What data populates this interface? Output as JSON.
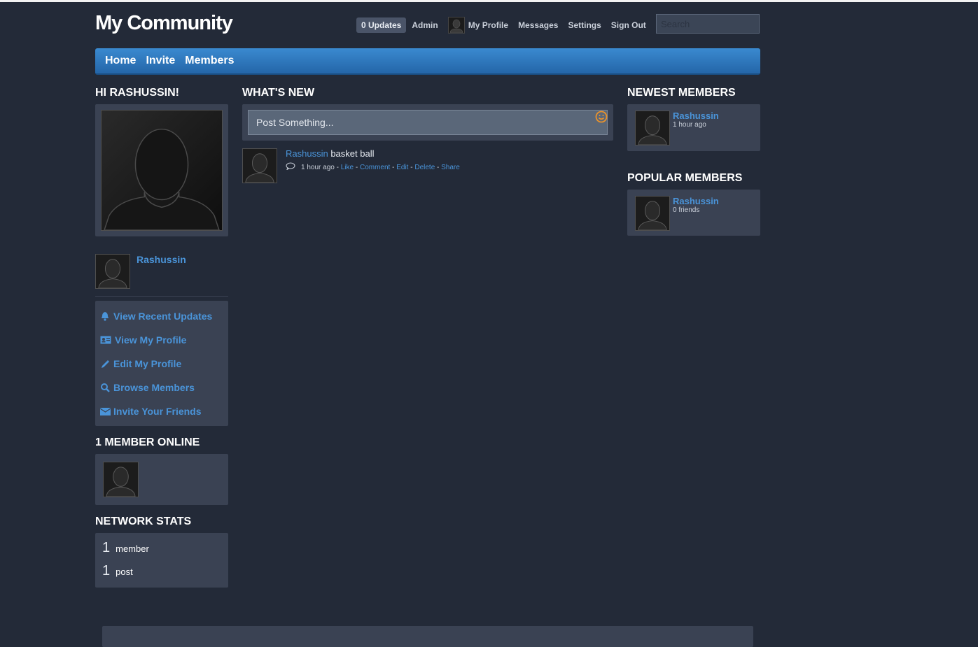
{
  "header": {
    "site_title": "My Community",
    "updates_label": "0 Updates",
    "admin_label": "Admin",
    "my_profile_label": "My Profile",
    "messages_label": "Messages",
    "settings_label": "Settings",
    "sign_out_label": "Sign Out",
    "search_placeholder": "Search"
  },
  "main_nav": [
    "Home",
    "Invite",
    "Members"
  ],
  "left": {
    "greeting": "HI RASHUSSIN!",
    "username": "Rashussin",
    "menu": [
      {
        "label": "View Recent Updates",
        "icon": "bell-icon"
      },
      {
        "label": "View My Profile",
        "icon": "profile-card-icon"
      },
      {
        "label": "Edit My Profile",
        "icon": "pencil-icon"
      },
      {
        "label": "Browse Members",
        "icon": "search-icon"
      },
      {
        "label": "Invite Your Friends",
        "icon": "envelope-icon"
      }
    ],
    "online_heading": "1 MEMBER ONLINE",
    "stats_heading": "NETWORK STATS",
    "stats": [
      {
        "number": "1",
        "label": "member"
      },
      {
        "number": "1",
        "label": "post"
      }
    ]
  },
  "center": {
    "heading": "WHAT'S NEW",
    "post_placeholder": "Post Something...",
    "feed": [
      {
        "author": "Rashussin",
        "text": "basket ball",
        "time": "1 hour ago",
        "actions": [
          "Like",
          "Comment",
          "Edit",
          "Delete",
          "Share"
        ]
      }
    ]
  },
  "right": {
    "newest_heading": "NEWEST MEMBERS",
    "newest": {
      "name": "Rashussin",
      "sub": "1 hour ago"
    },
    "popular_heading": "POPULAR MEMBERS",
    "popular": {
      "name": "Rashussin",
      "sub": "0 friends"
    }
  },
  "colors": {
    "background": "#232a38",
    "panel": "#3a4253",
    "link": "#4a94d9",
    "nav": "#2a74bb",
    "smiley": "#e8922c"
  }
}
